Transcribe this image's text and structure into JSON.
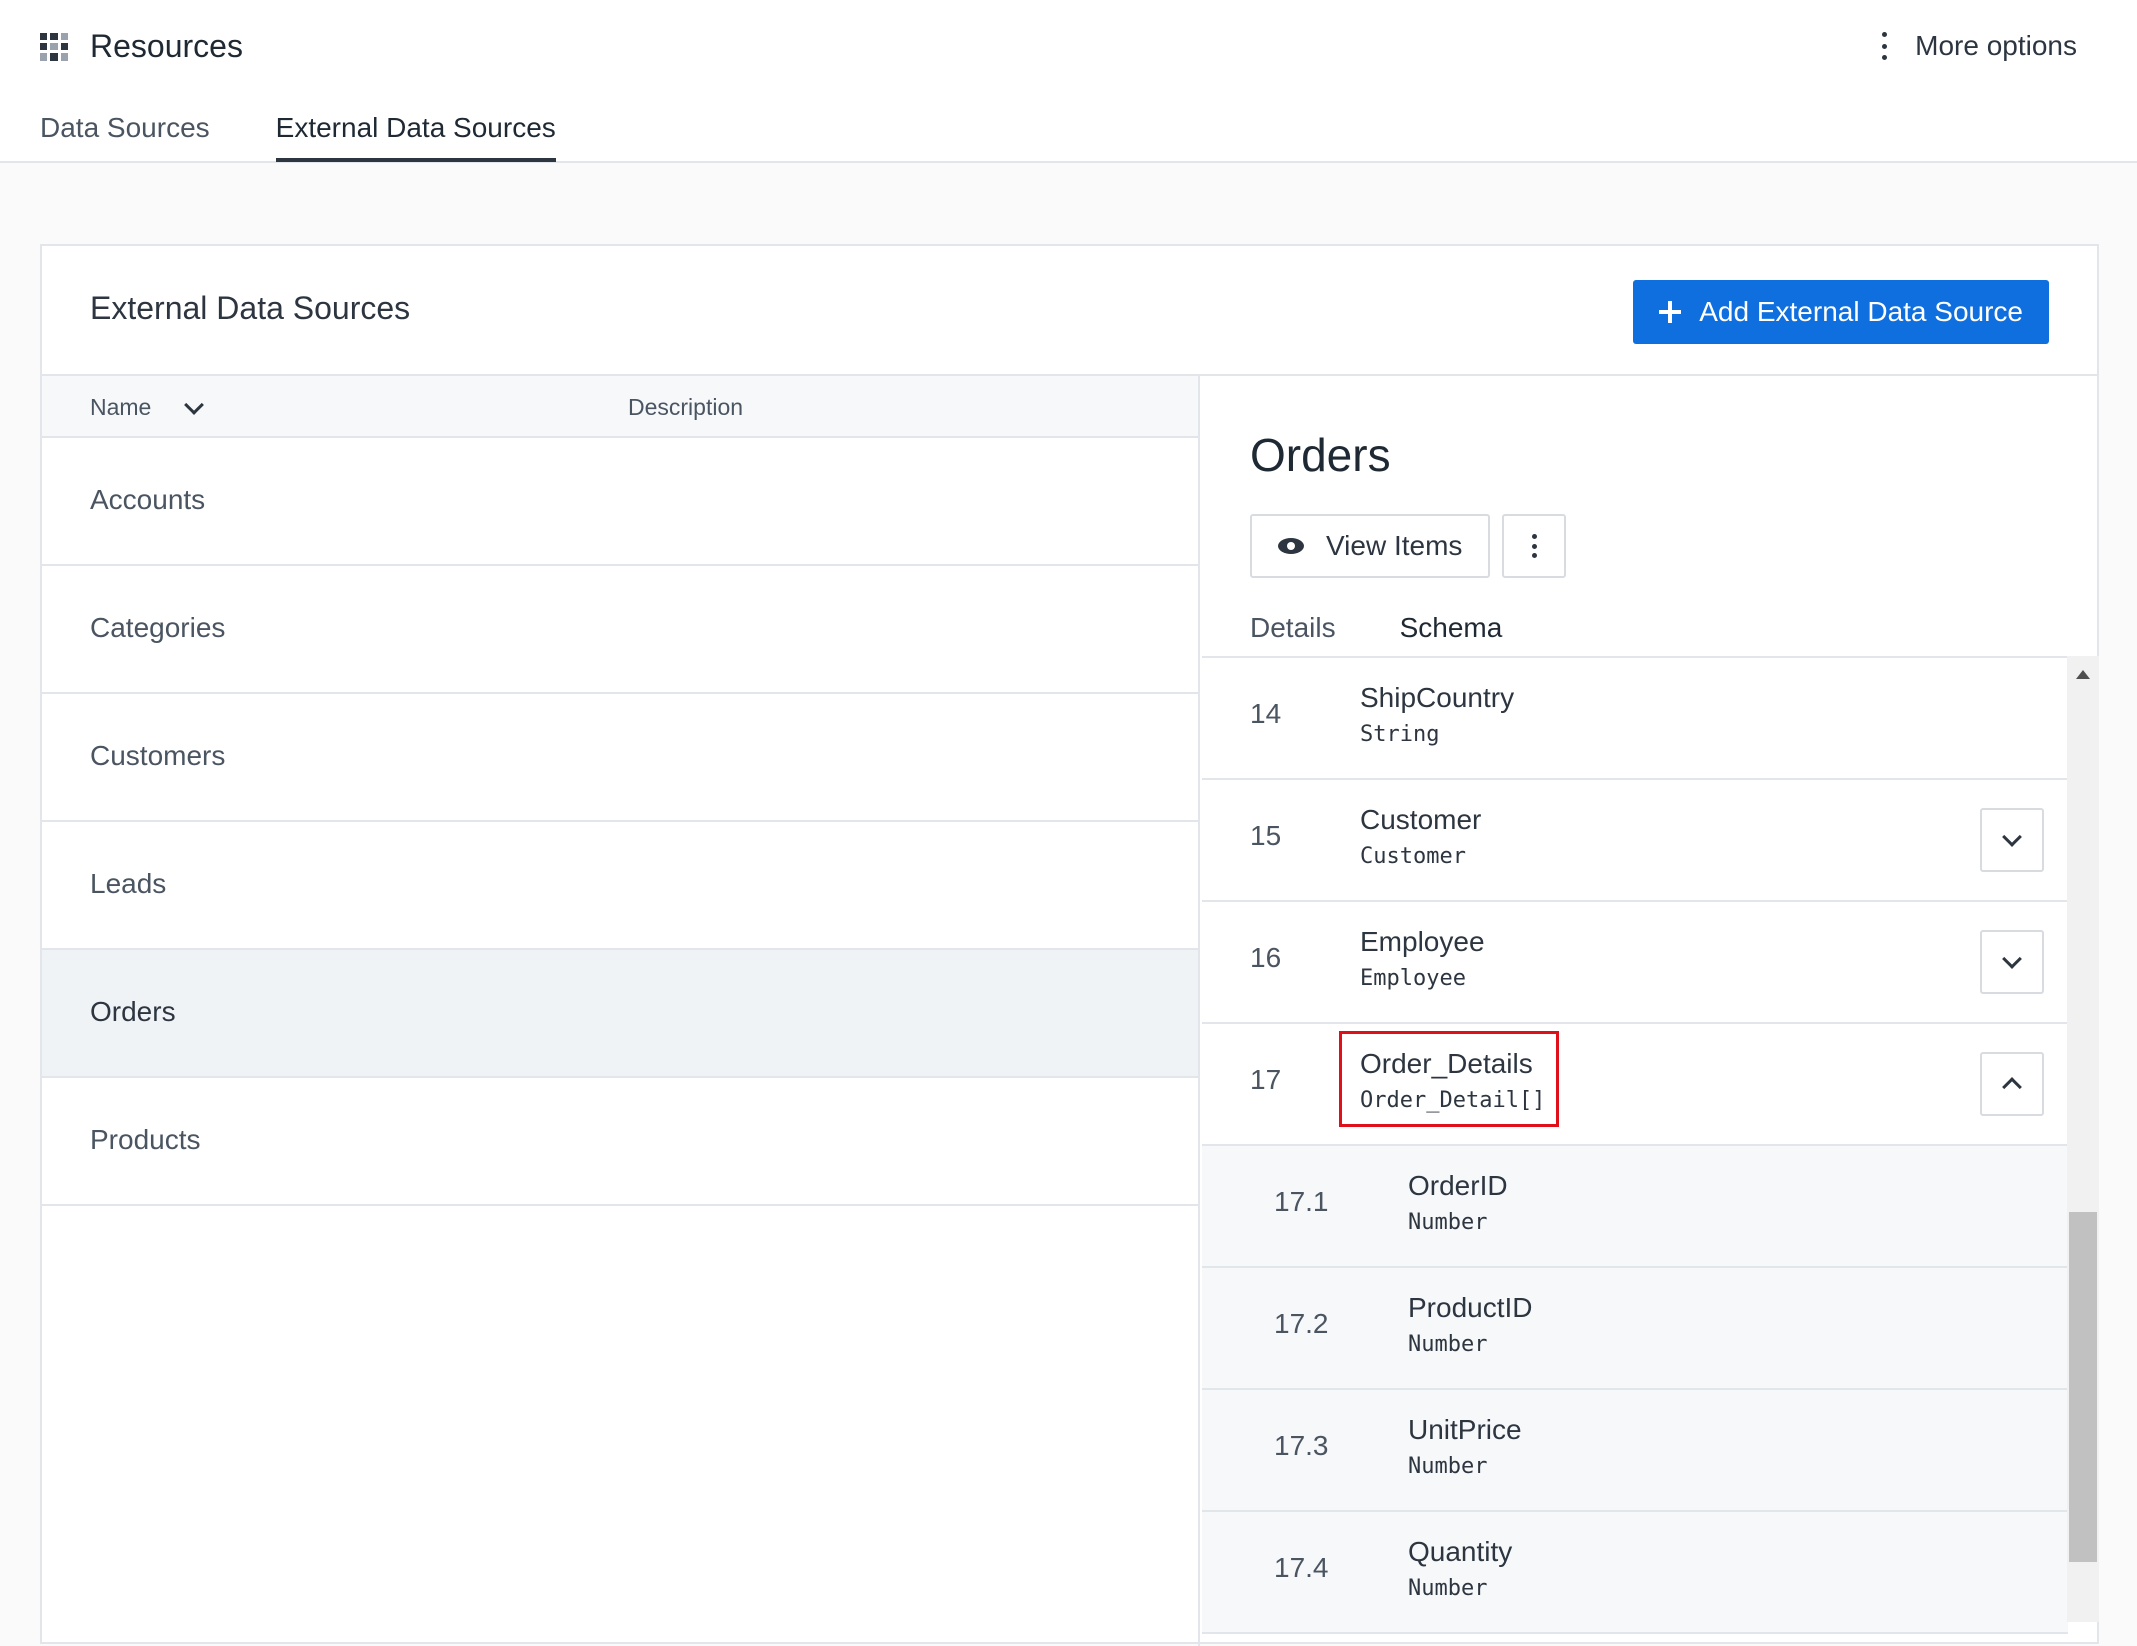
{
  "app": {
    "title": "Resources",
    "more_options": "More options"
  },
  "top_tabs": [
    {
      "label": "Data Sources",
      "active": false
    },
    {
      "label": "External Data Sources",
      "active": true
    }
  ],
  "card": {
    "title": "External Data Sources",
    "add_button": "Add External Data Source"
  },
  "list": {
    "columns": {
      "name": "Name",
      "description": "Description"
    },
    "items": [
      {
        "name": "Accounts"
      },
      {
        "name": "Categories"
      },
      {
        "name": "Customers"
      },
      {
        "name": "Leads"
      },
      {
        "name": "Orders",
        "selected": true
      },
      {
        "name": "Products"
      }
    ]
  },
  "detail": {
    "title": "Orders",
    "view_items": "View Items",
    "tabs": [
      {
        "label": "Details",
        "active": false
      },
      {
        "label": "Schema",
        "active": true
      }
    ],
    "schema": [
      {
        "num": "14",
        "name": "ShipCountry",
        "type": "String"
      },
      {
        "num": "15",
        "name": "Customer",
        "type": "Customer",
        "expandable": true,
        "expanded": false
      },
      {
        "num": "16",
        "name": "Employee",
        "type": "Employee",
        "expandable": true,
        "expanded": false
      },
      {
        "num": "17",
        "name": "Order_Details",
        "type": "Order_Detail[]",
        "expandable": true,
        "expanded": true
      },
      {
        "num": "17.1",
        "name": "OrderID",
        "type": "Number",
        "child": true
      },
      {
        "num": "17.2",
        "name": "ProductID",
        "type": "Number",
        "child": true
      },
      {
        "num": "17.3",
        "name": "UnitPrice",
        "type": "Number",
        "child": true
      },
      {
        "num": "17.4",
        "name": "Quantity",
        "type": "Number",
        "child": true
      }
    ]
  },
  "colors": {
    "primary": "#0f6fde",
    "highlight": "#e0101b",
    "selected_row": "#f0f3f6"
  },
  "icons": {
    "app": "grid-icon",
    "more": "kebab-icon",
    "add": "plus-icon",
    "sort": "chevron-down-icon",
    "view": "eye-icon"
  }
}
